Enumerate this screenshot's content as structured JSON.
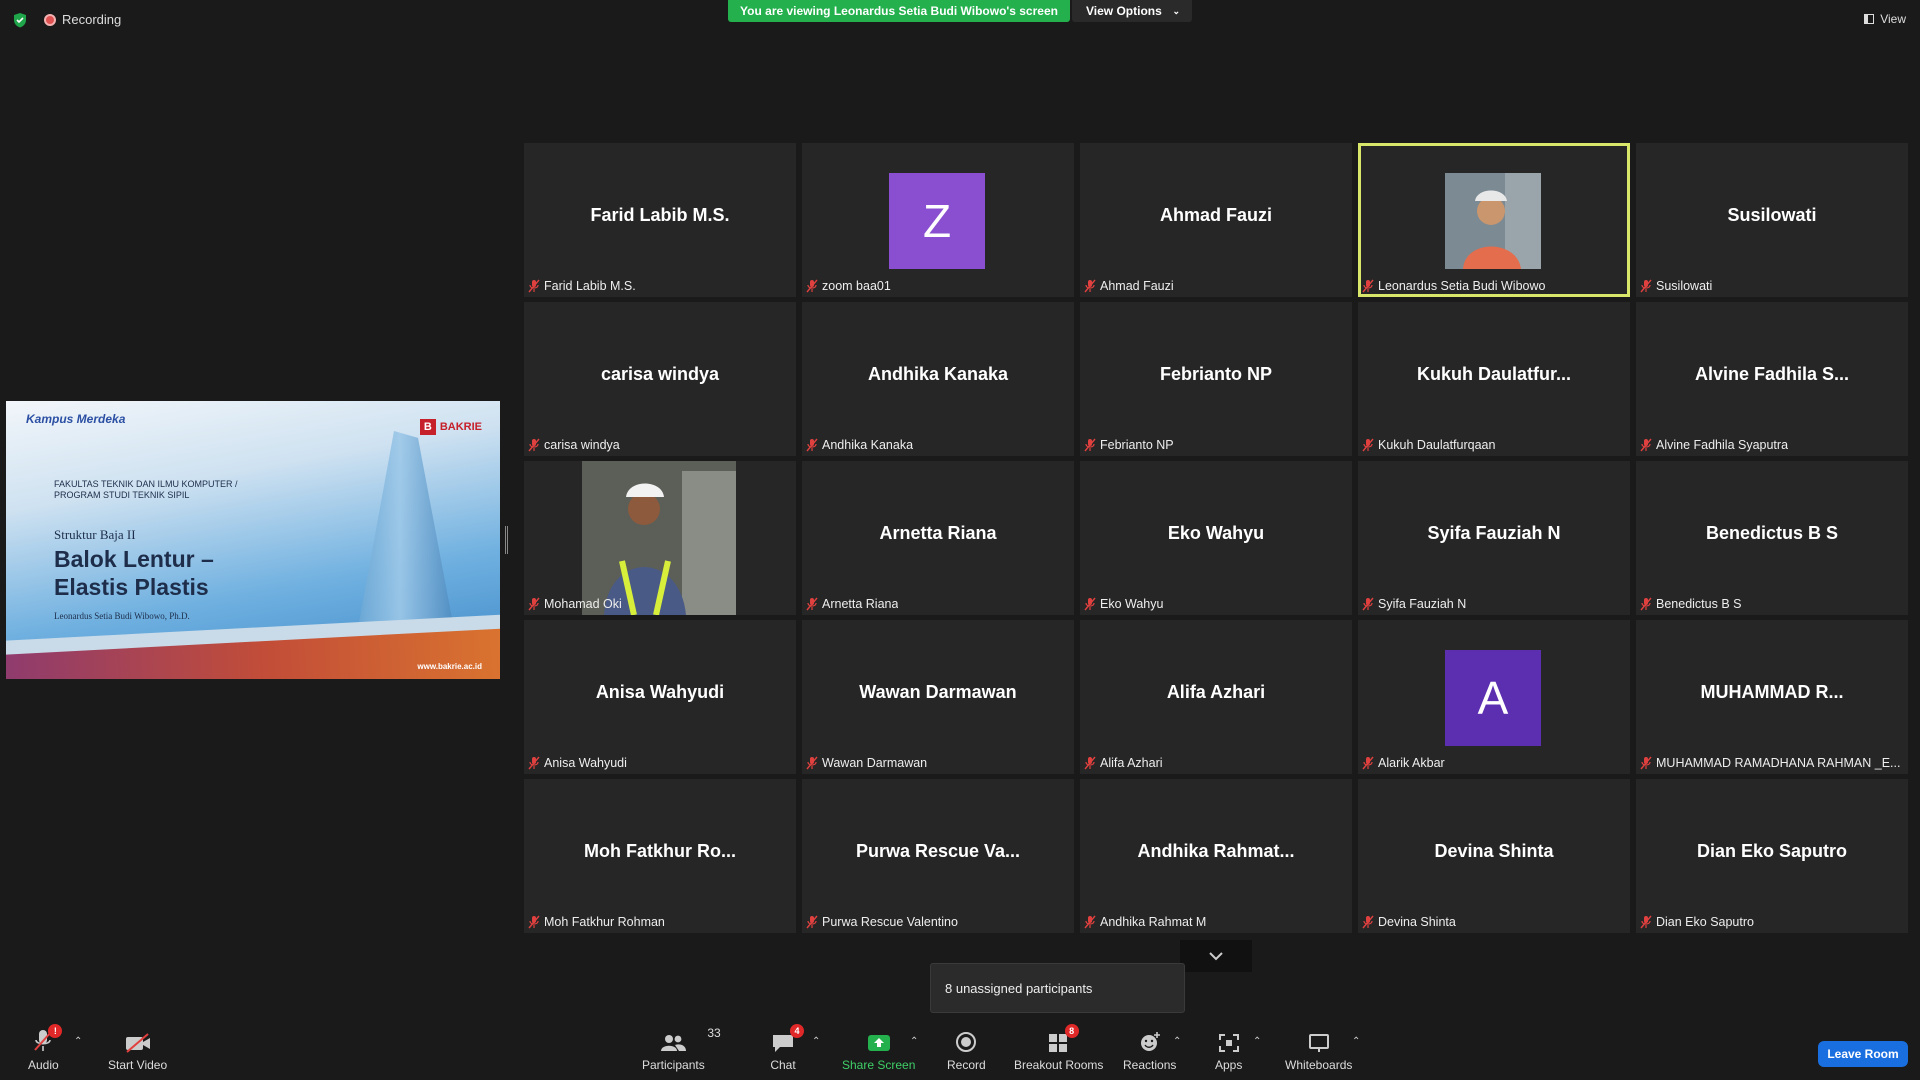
{
  "top": {
    "recording_label": "Recording",
    "viewing_banner": "You are viewing Leonardus Setia Budi Wibowo's screen",
    "view_options_label": "View Options",
    "view_label": "View"
  },
  "shared_slide": {
    "kampus_merdeka": "Kampus Merdeka",
    "university": "BAKRIE",
    "faculty_line1": "FAKULTAS TEKNIK DAN ILMU KOMPUTER /",
    "faculty_line2": "PROGRAM STUDI TEKNIK SIPIL",
    "course": "Struktur Baja II",
    "title_line1": "Balok Lentur –",
    "title_line2": "Elastis Plastis",
    "author": "Leonardus Setia Budi Wibowo, Ph.D.",
    "url": "www.bakrie.ac.id"
  },
  "participants_grid": [
    {
      "display": "Farid Labib M.S.",
      "name": "Farid Labib M.S."
    },
    {
      "display": "Z",
      "name": "zoom baa01",
      "avatar_color": "#8a4fd0"
    },
    {
      "display": "Ahmad Fauzi",
      "name": "Ahmad Fauzi"
    },
    {
      "display": "",
      "name": "Leonardus Setia Budi Wibowo",
      "active_speaker": true
    },
    {
      "display": "Susilowati",
      "name": "Susilowati"
    },
    {
      "display": "carisa windya",
      "name": "carisa windya"
    },
    {
      "display": "Andhika Kanaka",
      "name": "Andhika Kanaka"
    },
    {
      "display": "Febrianto NP",
      "name": "Febrianto NP"
    },
    {
      "display": "Kukuh  Daulatfur...",
      "name": "Kukuh Daulatfurqaan"
    },
    {
      "display": "Alvine  Fadhila  S...",
      "name": "Alvine Fadhila Syaputra"
    },
    {
      "display": "",
      "name": "Mohamad Oki"
    },
    {
      "display": "Arnetta Riana",
      "name": "Arnetta Riana"
    },
    {
      "display": "Eko Wahyu",
      "name": "Eko Wahyu"
    },
    {
      "display": "Syifa Fauziah N",
      "name": "Syifa Fauziah N"
    },
    {
      "display": "Benedictus B S",
      "name": "Benedictus B S"
    },
    {
      "display": "Anisa Wahyudi",
      "name": "Anisa Wahyudi"
    },
    {
      "display": "Wawan Darmawan",
      "name": "Wawan Darmawan"
    },
    {
      "display": "Alifa Azhari",
      "name": "Alifa Azhari"
    },
    {
      "display": "A",
      "name": "Alarik Akbar",
      "avatar_color": "#5b2fb0"
    },
    {
      "display": "MUHAMMAD  R...",
      "name": "MUHAMMAD RAMADHANA RAHMAN _E..."
    },
    {
      "display": "Moh  Fatkhur  Ro...",
      "name": "Moh Fatkhur Rohman"
    },
    {
      "display": "Purwa Rescue Va...",
      "name": "Purwa Rescue Valentino"
    },
    {
      "display": "Andhika  Rahmat...",
      "name": "Andhika Rahmat M"
    },
    {
      "display": "Devina Shinta",
      "name": "Devina Shinta"
    },
    {
      "display": "Dian Eko Saputro",
      "name": "Dian Eko Saputro"
    }
  ],
  "tooltip": "8 unassigned participants",
  "toolbar": {
    "audio": "Audio",
    "audio_badge": "!",
    "start_video": "Start Video",
    "participants": "Participants",
    "participants_count": "33",
    "chat": "Chat",
    "chat_badge": "4",
    "share_screen": "Share Screen",
    "record": "Record",
    "breakout_rooms": "Breakout Rooms",
    "breakout_badge": "8",
    "reactions": "Reactions",
    "apps": "Apps",
    "whiteboards": "Whiteboards",
    "leave_room": "Leave Room"
  },
  "colors": {
    "accent_green": "#23b04d",
    "active_border": "#d8e66a",
    "leave_blue": "#1a6fe0",
    "mute_red": "#e0413f"
  }
}
